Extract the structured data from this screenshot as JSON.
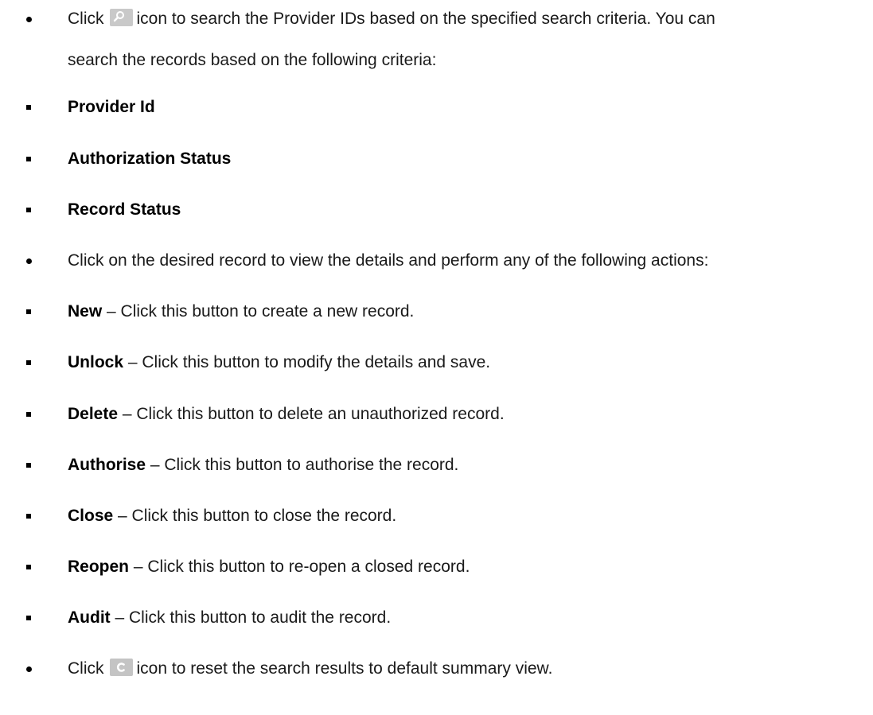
{
  "items": [
    {
      "kind": "round",
      "pre": "Click",
      "icon": "search-icon",
      "post": "icon to search the Provider IDs based on the specified search criteria. You can",
      "continuation": "search the records based on the following criteria:"
    },
    {
      "kind": "square",
      "label": "Provider Id"
    },
    {
      "kind": "square",
      "label": "Authorization Status"
    },
    {
      "kind": "square",
      "label": "Record Status"
    },
    {
      "kind": "round",
      "text": "Click on the desired record to view the details and perform any of the following actions:"
    },
    {
      "kind": "square",
      "label": "New",
      "desc": " – Click this button to create a new record."
    },
    {
      "kind": "square",
      "label": "Unlock",
      "desc": " – Click this button to modify the details and save."
    },
    {
      "kind": "square",
      "label": "Delete",
      "desc": " – Click this button to delete an unauthorized record."
    },
    {
      "kind": "square",
      "label": "Authorise",
      "desc": " – Click this button to authorise the record."
    },
    {
      "kind": "square",
      "label": "Close",
      "desc": " – Click this button to close the record."
    },
    {
      "kind": "square",
      "label": "Reopen",
      "desc": " – Click this button to re-open a closed record."
    },
    {
      "kind": "square",
      "label": "Audit",
      "desc": " – Click this button to audit the record."
    },
    {
      "kind": "round",
      "pre": "Click",
      "icon": "reset-icon",
      "post": "icon to reset the search results to default summary view."
    }
  ],
  "colors": {
    "text": "#1a1a1a",
    "icon_bg": "#c9c9c9",
    "icon_glyph": "#ffffff"
  }
}
